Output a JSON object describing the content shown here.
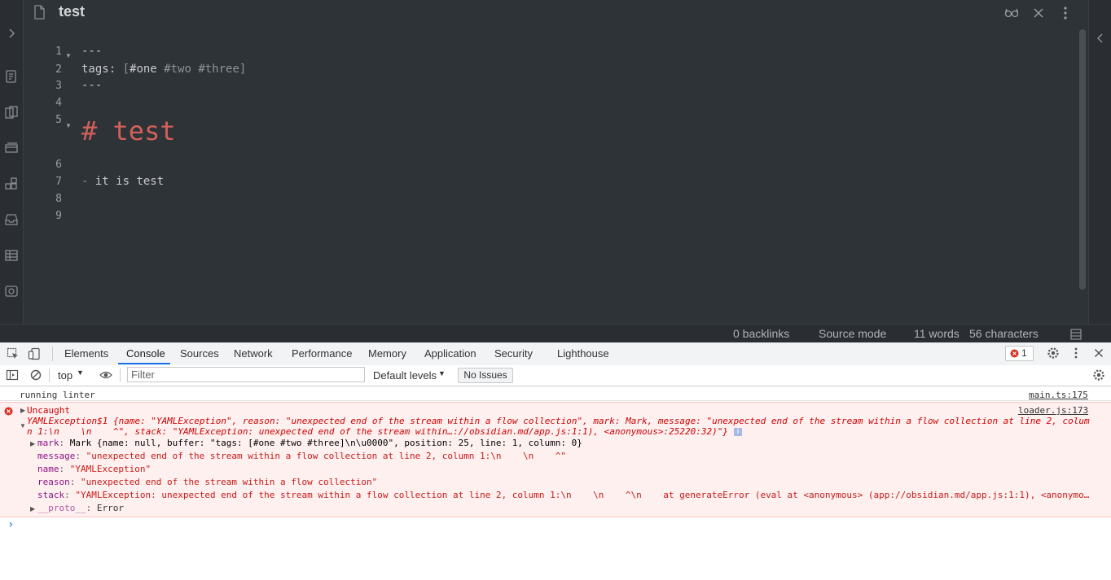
{
  "editor": {
    "tab_title": "test",
    "lines": [
      {
        "num": "1",
        "text": "---"
      },
      {
        "num": "2",
        "key": "tags: ",
        "open": "[",
        "tag1": "#one",
        "tag2": " #two",
        "tag3": " #three",
        "close": "]"
      },
      {
        "num": "3",
        "text": "---"
      },
      {
        "num": "4",
        "text": ""
      },
      {
        "num": "5",
        "text": "# test"
      },
      {
        "num": "6",
        "text": ""
      },
      {
        "num": "7",
        "bullet": "-",
        "text": " it is test"
      },
      {
        "num": "8",
        "text": ""
      },
      {
        "num": "9",
        "text": ""
      }
    ]
  },
  "statusbar": {
    "backlinks": "0 backlinks",
    "mode": "Source mode",
    "words": "11 words",
    "chars": "56 characters"
  },
  "devtools": {
    "tabs": [
      "Elements",
      "Console",
      "Sources",
      "Network",
      "Performance",
      "Memory",
      "Application",
      "Security",
      "Lighthouse"
    ],
    "error_count": "1",
    "context": "top",
    "filter_placeholder": "Filter",
    "levels": "Default levels",
    "issues": "No Issues"
  },
  "console": {
    "log1_text": "running linter",
    "log1_source": "main.ts:175",
    "err_header": "Uncaught",
    "err_source": "loader.js:173",
    "err_summary_1": "YAMLException$1 {name: \"YAMLException\", reason: \"unexpected end of the stream within a flow collection\", mark: Mark, message: \"unexpected end of the stream within a flow collection at line 2, colum",
    "err_summary_2": "n 1:\\n    \\n    ^\", stack: \"YAMLException: unexpected end of the stream within…://obsidian.md/app.js:1:1), <anonymous>:25220:32)\"}",
    "mark_key": "mark",
    "mark_value": "Mark {name: null, buffer: \"tags: [#one #two #three]\\n\\u0000\", position: 25, line: 1, column: 0}",
    "message_key": "message",
    "message_value": "\"unexpected end of the stream within a flow collection at line 2, column 1:\\n    \\n    ^\"",
    "name_key": "name",
    "name_value": "\"YAMLException\"",
    "reason_key": "reason",
    "reason_value": "\"unexpected end of the stream within a flow collection\"",
    "stack_key": "stack",
    "stack_value": "\"YAMLException: unexpected end of the stream within a flow collection at line 2, column 1:\\n    \\n    ^\\n    at generateError (eval at <anonymous> (app://obsidian.md/app.js:1:1), <anonymo…",
    "proto_key": "__proto__",
    "proto_value": "Error",
    "prompt": "›"
  },
  "colors": {
    "heading": "#d0605a",
    "error_bg": "#fff0f0",
    "active_tab": "#1a73e8"
  }
}
